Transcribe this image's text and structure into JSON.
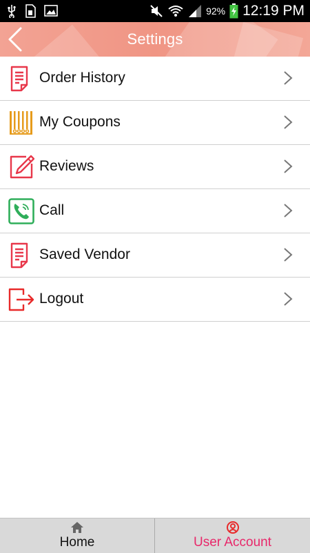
{
  "status_bar": {
    "battery_percent": "92%",
    "time": "12:19 PM",
    "icons": [
      "usb-icon",
      "sd-card-icon",
      "image-icon",
      "mute-icon",
      "wifi-icon",
      "signal-icon",
      "battery-charging-icon"
    ]
  },
  "header": {
    "title": "Settings",
    "back_icon": "back-arrow-icon"
  },
  "menu": {
    "items": [
      {
        "label": "Order History",
        "icon": "document-icon"
      },
      {
        "label": "My Coupons",
        "icon": "barcode-icon"
      },
      {
        "label": "Reviews",
        "icon": "edit-pencil-icon"
      },
      {
        "label": "Call",
        "icon": "phone-icon"
      },
      {
        "label": "Saved Vendor",
        "icon": "document-icon"
      },
      {
        "label": "Logout",
        "icon": "logout-icon"
      }
    ]
  },
  "bottom_nav": {
    "tabs": [
      {
        "label": "Home",
        "icon": "home-icon",
        "active": false
      },
      {
        "label": "User Account",
        "icon": "user-account-icon",
        "active": true
      }
    ]
  },
  "colors": {
    "header_bg": "#f09584",
    "icon_red": "#e8374a",
    "icon_orange": "#e69b1b",
    "icon_green": "#2fae5a",
    "active_tab": "#e8286a"
  }
}
